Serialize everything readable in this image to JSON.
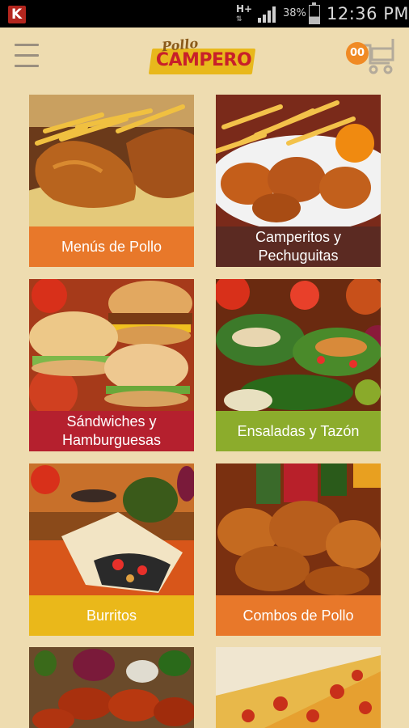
{
  "status_bar": {
    "network": "H+",
    "battery": "38%",
    "time": "12:36 PM"
  },
  "header": {
    "logo_script": "Pollo",
    "logo_text": "CAMPERO",
    "cart_count": "00"
  },
  "menu_tiles": [
    {
      "label": "Menús de Pollo",
      "color": "#e8782a"
    },
    {
      "label": "Camperitos y Pechuguitas",
      "color": "#5b2a22"
    },
    {
      "label": "Sándwiches y Hamburguesas",
      "color": "#b5202e"
    },
    {
      "label": "Ensaladas y Tazón",
      "color": "#8cac2c"
    },
    {
      "label": "Burritos",
      "color": "#eab81a"
    },
    {
      "label": "Combos de Pollo",
      "color": "#e8782a"
    },
    {
      "label": "",
      "color": "#000000"
    },
    {
      "label": "",
      "color": "#000000"
    }
  ],
  "colors": {
    "background": "#eedcb0",
    "status_bar": "#000000",
    "cart_badge": "#f08a24"
  }
}
